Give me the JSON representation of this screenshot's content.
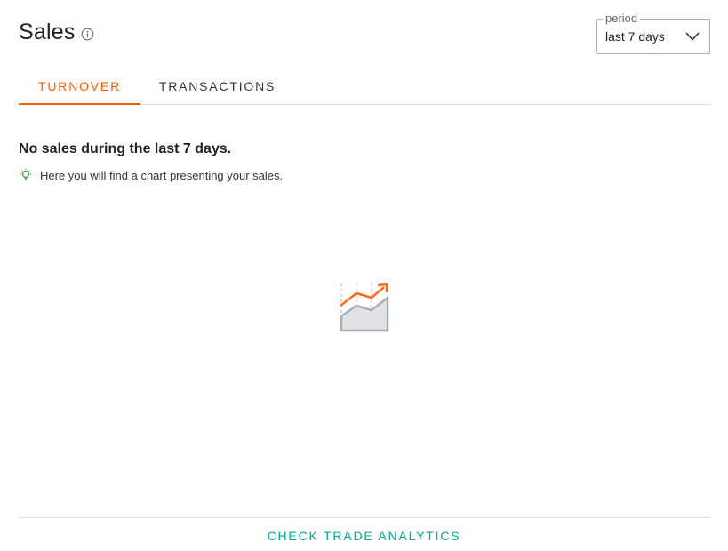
{
  "header": {
    "title": "Sales",
    "info_icon": "info-circle-icon"
  },
  "period": {
    "legend": "period",
    "selected": "last 7 days",
    "icon": "chevron-down-icon"
  },
  "tabs": [
    {
      "label": "TURNOVER",
      "active": true
    },
    {
      "label": "TRANSACTIONS",
      "active": false
    }
  ],
  "empty_state": {
    "heading": "No sales during the last 7 days.",
    "hint_icon": "lightbulb-icon",
    "hint": "Here you will find a chart presenting your sales.",
    "illustration_icon": "trend-chart-icon"
  },
  "footer": {
    "link_label": "CHECK TRADE ANALYTICS"
  },
  "colors": {
    "accent": "#ff5a00",
    "link": "#00a790",
    "hint_icon": "#2e9b3a"
  }
}
